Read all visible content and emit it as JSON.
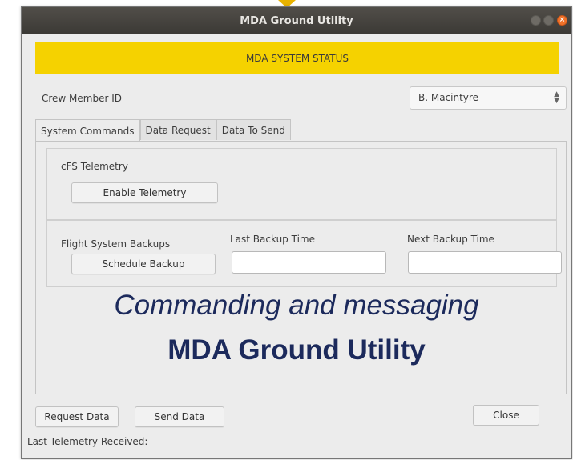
{
  "window": {
    "title": "MDA Ground Utility",
    "close_glyph": "×"
  },
  "status": {
    "text": "MDA SYSTEM STATUS",
    "color": "#f5d200"
  },
  "crew": {
    "label": "Crew Member ID",
    "selected": "B. Macintyre"
  },
  "tabs": [
    {
      "label": "System Commands",
      "active": true
    },
    {
      "label": "Data Request",
      "active": false
    },
    {
      "label": "Data To Send",
      "active": false
    }
  ],
  "telemetry": {
    "heading": "cFS Telemetry",
    "enable_button": "Enable Telemetry"
  },
  "backups": {
    "heading": "Flight System Backups",
    "schedule_button": "Schedule Backup",
    "last_label": "Last Backup Time",
    "last_value": "",
    "next_label": "Next Backup Time",
    "next_value": ""
  },
  "overlay": {
    "line1": "Commanding and messaging",
    "line2": "MDA Ground Utility"
  },
  "footer": {
    "request_button": "Request Data",
    "send_button": "Send Data",
    "close_button": "Close",
    "last_telemetry_label": "Last Telemetry Received:"
  }
}
